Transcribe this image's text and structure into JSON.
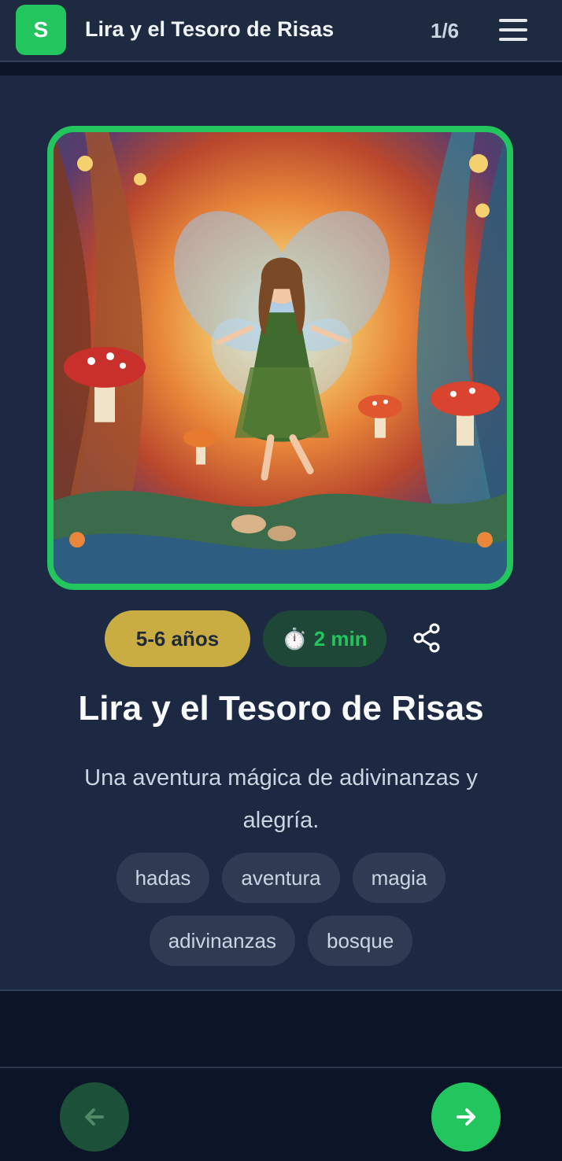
{
  "header": {
    "logo_letter": "S",
    "title": "Lira y el Tesoro de Risas",
    "page_counter": "1/6",
    "menu_icon": "hamburger-menu-icon"
  },
  "story": {
    "age": "5-6 años",
    "duration": "2 min",
    "timer_icon": "⏱️",
    "share_icon": "share-icon",
    "title": "Lira y el Tesoro de Risas",
    "description": "Una aventura mágica de adivinanzas y alegría.",
    "tags": [
      "hadas",
      "aventura",
      "magia",
      "adivinanzas",
      "bosque"
    ]
  },
  "navigation": {
    "prev_icon": "arrow-left-icon",
    "next_icon": "arrow-right-icon"
  },
  "colors": {
    "accent": "#22c55e",
    "age_badge": "#c9ad43",
    "background": "#1d2942"
  }
}
